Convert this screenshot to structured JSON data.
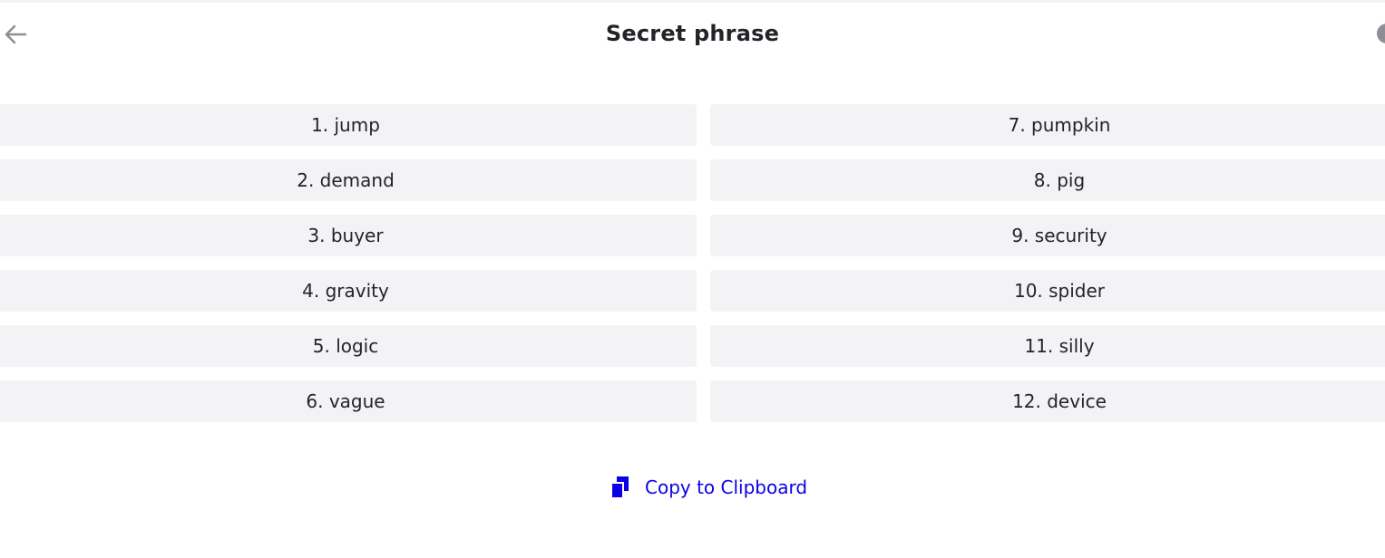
{
  "header": {
    "title": "Secret phrase",
    "back_icon": "arrow-left-icon"
  },
  "words": {
    "left": [
      "1. jump",
      "2. demand",
      "3. buyer",
      "4. gravity",
      "5. logic",
      "6. vague"
    ],
    "right": [
      "7. pumpkin",
      "8. pig",
      "9. security",
      "10. spider",
      "11. silly",
      "12. device"
    ]
  },
  "actions": {
    "copy_label": "Copy to Clipboard",
    "copy_icon": "copy-icon"
  },
  "colors": {
    "accent": "#0b00e6",
    "box_bg": "#f3f3f5",
    "text": "#232329",
    "icon_gray": "#8e8e96"
  }
}
